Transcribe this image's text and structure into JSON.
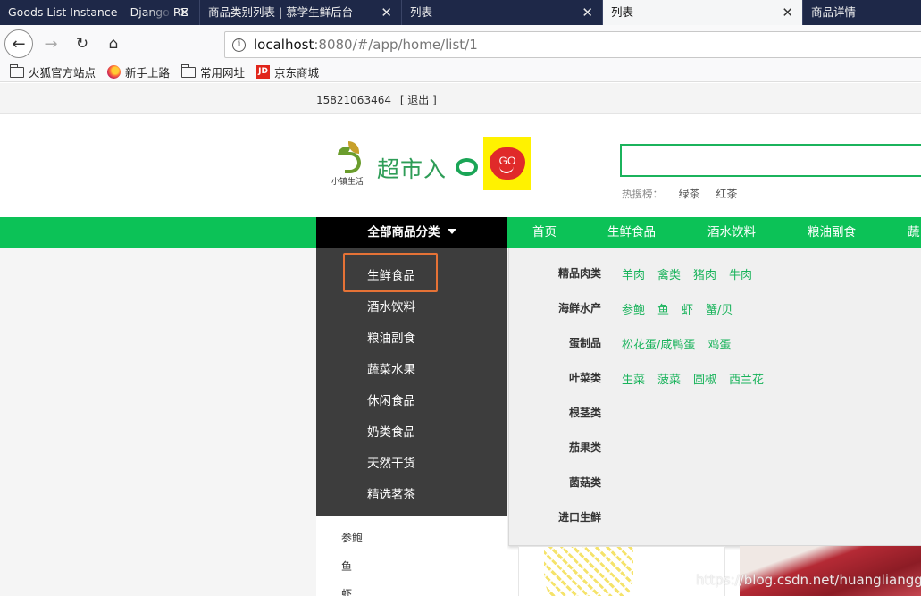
{
  "browser": {
    "tabs": [
      {
        "title": "Goods List Instance – Django RE",
        "active": false
      },
      {
        "title": "商品类别列表 | 慕学生鲜后台",
        "active": false
      },
      {
        "title": "列表",
        "active": false
      },
      {
        "title": "列表",
        "active": true
      },
      {
        "title": "商品详情",
        "active": false
      }
    ],
    "url_host": "localhost",
    "url_path": ":8080/#/app/home/list/1",
    "bookmarks": [
      "火狐官方站点",
      "新手上路",
      "常用网址",
      "京东商城"
    ]
  },
  "topbar": {
    "user": "15821063464",
    "logout": "[ 退出 ]"
  },
  "header": {
    "brand": "超市入",
    "logo_sub": "小镇生活",
    "go_badge": "GO",
    "search_placeholder": "",
    "hot_label": "热搜榜：",
    "hot_words": [
      "绿茶",
      "红茶"
    ]
  },
  "nav": {
    "all_categories": "全部商品分类",
    "links": [
      "首页",
      "生鲜食品",
      "酒水饮料",
      "粮油副食",
      "蔬"
    ]
  },
  "category_menu": [
    "生鲜食品",
    "酒水饮料",
    "粮油副食",
    "蔬菜水果",
    "休闲食品",
    "奶类食品",
    "天然干货",
    "精选茗茶"
  ],
  "sub_panel": [
    {
      "head": "精品肉类",
      "items": [
        "羊肉",
        "禽类",
        "猪肉",
        "牛肉"
      ]
    },
    {
      "head": "海鲜水产",
      "items": [
        "参鲍",
        "鱼",
        "虾",
        "蟹/贝"
      ]
    },
    {
      "head": "蛋制品",
      "items": [
        "松花蛋/咸鸭蛋",
        "鸡蛋"
      ]
    },
    {
      "head": "叶菜类",
      "items": [
        "生菜",
        "菠菜",
        "圆椒",
        "西兰花"
      ]
    },
    {
      "head": "根茎类",
      "items": []
    },
    {
      "head": "茄果类",
      "items": []
    },
    {
      "head": "菌菇类",
      "items": []
    },
    {
      "head": "进口生鲜",
      "items": []
    }
  ],
  "left_list": [
    "参鲍",
    "鱼",
    "虾"
  ],
  "watermark": "https://blog.csdn.net/huangliangguj",
  "colors": {
    "green": "#0cc257",
    "dark_menu": "#3d3d3d",
    "highlight": "#e57236",
    "tabbar": "#1e2848"
  }
}
